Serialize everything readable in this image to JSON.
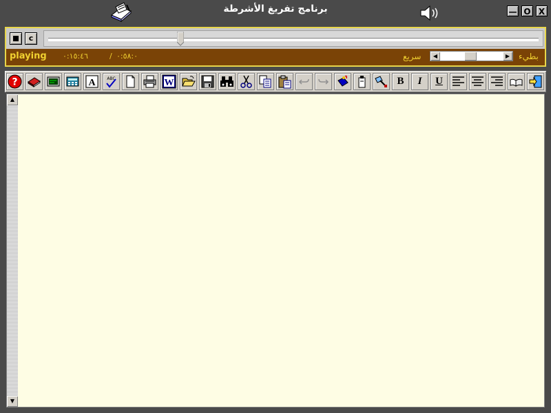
{
  "window": {
    "title": "برنامج تفريغ الأشرطة",
    "min_label": "—",
    "max_label": "O",
    "close_label": "X"
  },
  "player": {
    "stop_icon": "stop-icon",
    "clear_label": "c",
    "status": "playing",
    "elapsed": "٠:١٥:٤٦",
    "separator": "/",
    "total": "٠:٥٨:٠",
    "speed_fast_label": "سريع",
    "speed_slow_label": "بطيء",
    "speed_left_arrow": "◀",
    "speed_right_arrow": "▶",
    "seek_position": 0.27,
    "speed_position": 0.48
  },
  "toolbar": {
    "bold_label": "B",
    "italic_label": "I",
    "underline_label": "U",
    "text_label": "A",
    "word_label": "W",
    "spell_label": "ABC"
  },
  "editor": {
    "content": "",
    "scroll_up": "▲",
    "scroll_down": "▼"
  },
  "colors": {
    "background": "#4a4a4a",
    "player_panel": "#7a4306",
    "player_border": "#e8d64a",
    "player_text": "#f0d030",
    "editor_bg": "#fefde4"
  }
}
